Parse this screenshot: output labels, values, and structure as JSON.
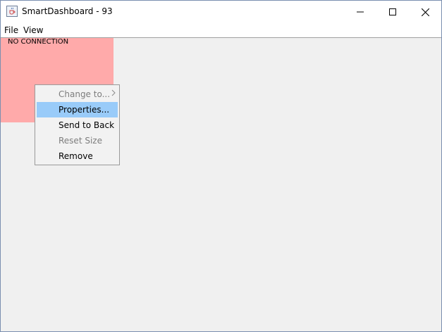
{
  "window": {
    "title": "SmartDashboard - 93",
    "icon": "java-coffee-icon",
    "controls": [
      "minimize-icon",
      "maximize-icon",
      "close-icon"
    ]
  },
  "menubar": {
    "items": [
      {
        "label": "File"
      },
      {
        "label": "View"
      }
    ]
  },
  "widget": {
    "text": "NO CONNECTION",
    "color": "#ffaaaa"
  },
  "context_menu": {
    "highlight_color": "#99cbf9",
    "items": [
      {
        "label": "Change to...",
        "enabled": false,
        "submenu": true
      },
      {
        "label": "Properties...",
        "enabled": true,
        "highlighted": true
      },
      {
        "label": "Send to Back",
        "enabled": true
      },
      {
        "label": "Reset Size",
        "enabled": false
      },
      {
        "label": "Remove",
        "enabled": true
      }
    ]
  }
}
